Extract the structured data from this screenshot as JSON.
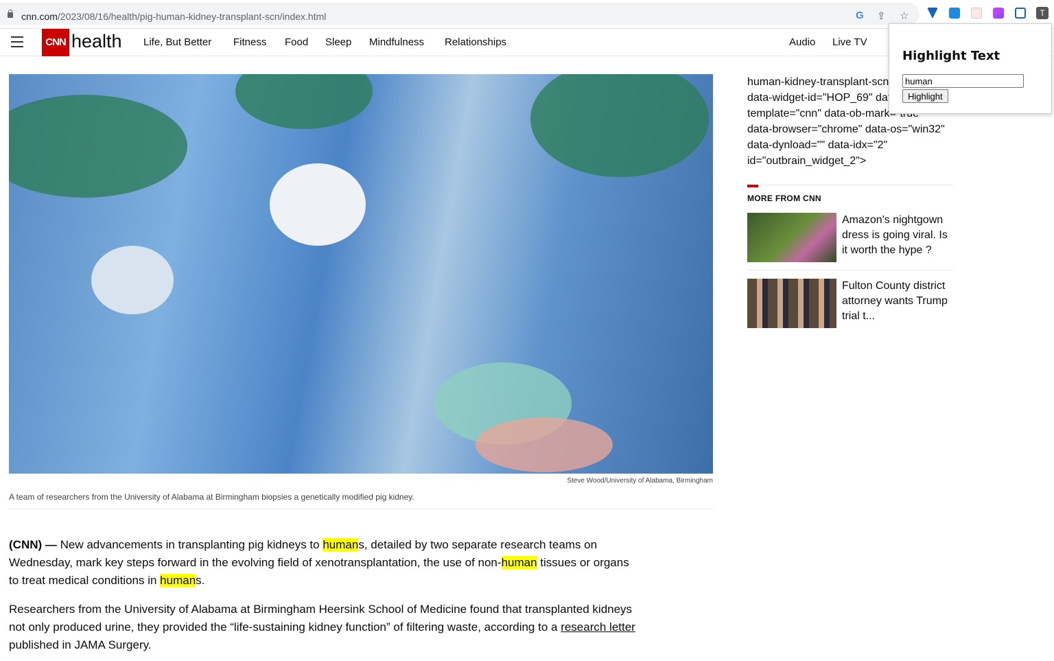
{
  "browser": {
    "url_host": "cnn.com",
    "url_path": "/2023/08/16/health/pig-human-kidney-transplant-scn/index.html",
    "profile_initial": "T"
  },
  "nav": {
    "brand": "CNN",
    "section": "health",
    "items": [
      "Life, But Better",
      "Fitness",
      "Food",
      "Sleep",
      "Mindfulness",
      "Relationships"
    ],
    "right": [
      "Audio",
      "Live TV"
    ]
  },
  "article": {
    "photo_credit": "Steve Wood/University of Alabama, Birmingham",
    "caption": "A team of researchers from the University of Alabama at Birmingham biopsies a genetically modified pig kidney.",
    "p1": {
      "dateline": "(CNN) —",
      "t1": " New advancements in transplanting pig kidneys to ",
      "h1": "human",
      "t2": "s, detailed by two separate research teams on Wednesday, mark key steps forward in the evolving field of xenotransplantation, the use of non-",
      "h2": "human",
      "t3": " tissues or organs to treat medical conditions in ",
      "h3": "human",
      "t4": "s."
    },
    "p2": {
      "t1": "Researchers from the University of Alabama at Birmingham Heersink School of Medicine found that transplanted kidneys not only produced urine, they provided the “life-sustaining kidney function” of filtering waste, according to a ",
      "link": "research letter",
      "t2": " published in JAMA Surgery."
    }
  },
  "sidebar": {
    "code_text": "human-kidney-transplant-scn/index.html\" data-widget-id=\"HOP_69\" data-ob-template=\"cnn\" data-ob-mark=\"true\" data-browser=\"chrome\" data-os=\"win32\" data-dynload=\"\" data-idx=\"2\" id=\"outbrain_widget_2\">",
    "heading": "MORE FROM CNN",
    "cards": [
      {
        "title": "Amazon's nightgown dress is going viral. Is it worth the hype ?"
      },
      {
        "title": "Fulton County district attorney wants Trump trial t..."
      }
    ]
  },
  "popup": {
    "title": "Highlight Text",
    "input_value": "human",
    "button": "Highlight"
  },
  "colors": {
    "brand": "#cc0000",
    "highlight": "#ffff00"
  }
}
